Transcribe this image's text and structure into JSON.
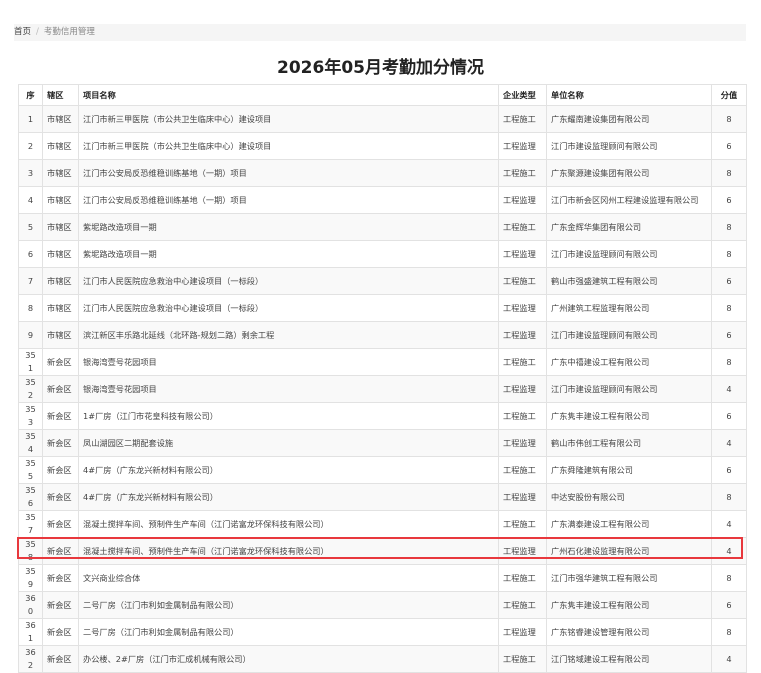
{
  "breadcrumb": {
    "home": "首页",
    "separator": "/",
    "current": "考勤信用管理"
  },
  "page_title": "2026年05月考勤加分情况",
  "table": {
    "headers": {
      "seq": "序",
      "district": "辖区",
      "project": "项目名称",
      "type": "企业类型",
      "unit": "单位名称",
      "score": "分值"
    },
    "rows": [
      {
        "seq": "1",
        "district": "市辖区",
        "project": "江门市新三甲医院（市公共卫生临床中心）建设项目",
        "type": "工程施工",
        "unit": "广东耀南建设集团有限公司",
        "score": "8"
      },
      {
        "seq": "2",
        "district": "市辖区",
        "project": "江门市新三甲医院（市公共卫生临床中心）建设项目",
        "type": "工程监理",
        "unit": "江门市建设监理顾问有限公司",
        "score": "6"
      },
      {
        "seq": "3",
        "district": "市辖区",
        "project": "江门市公安局反恐维稳训练基地（一期）项目",
        "type": "工程施工",
        "unit": "广东聚源建设集团有限公司",
        "score": "8"
      },
      {
        "seq": "4",
        "district": "市辖区",
        "project": "江门市公安局反恐维稳训练基地（一期）项目",
        "type": "工程监理",
        "unit": "江门市新会区冈州工程建设监理有限公司",
        "score": "6"
      },
      {
        "seq": "5",
        "district": "市辖区",
        "project": "紫坭路改造项目一期",
        "type": "工程施工",
        "unit": "广东金辉华集团有限公司",
        "score": "8"
      },
      {
        "seq": "6",
        "district": "市辖区",
        "project": "紫坭路改造项目一期",
        "type": "工程监理",
        "unit": "江门市建设监理顾问有限公司",
        "score": "8"
      },
      {
        "seq": "7",
        "district": "市辖区",
        "project": "江门市人民医院应急救治中心建设项目（一标段）",
        "type": "工程施工",
        "unit": "鹤山市强盛建筑工程有限公司",
        "score": "6"
      },
      {
        "seq": "8",
        "district": "市辖区",
        "project": "江门市人民医院应急救治中心建设项目（一标段）",
        "type": "工程监理",
        "unit": "广州建筑工程监理有限公司",
        "score": "8"
      },
      {
        "seq": "9",
        "district": "市辖区",
        "project": "滨江新区丰乐路北延线（北环路-规划二路）剩余工程",
        "type": "工程监理",
        "unit": "江门市建设监理顾问有限公司",
        "score": "6"
      },
      {
        "seq": "351",
        "district": "新会区",
        "project": "银海湾壹号花园项目",
        "type": "工程施工",
        "unit": "广东中禧建设工程有限公司",
        "score": "8"
      },
      {
        "seq": "352",
        "district": "新会区",
        "project": "银海湾壹号花园项目",
        "type": "工程监理",
        "unit": "江门市建设监理顾问有限公司",
        "score": "4"
      },
      {
        "seq": "353",
        "district": "新会区",
        "project": "1#厂房（江门市花皇科技有限公司）",
        "type": "工程施工",
        "unit": "广东隽丰建设工程有限公司",
        "score": "6"
      },
      {
        "seq": "354",
        "district": "新会区",
        "project": "凤山湖园区二期配套设施",
        "type": "工程监理",
        "unit": "鹤山市伟创工程有限公司",
        "score": "4"
      },
      {
        "seq": "355",
        "district": "新会区",
        "project": "4#厂房（广东龙兴新材料有限公司）",
        "type": "工程施工",
        "unit": "广东舜隆建筑有限公司",
        "score": "6"
      },
      {
        "seq": "356",
        "district": "新会区",
        "project": "4#厂房（广东龙兴新材料有限公司）",
        "type": "工程监理",
        "unit": "中达安股份有限公司",
        "score": "8"
      },
      {
        "seq": "357",
        "district": "新会区",
        "project": "混凝土搅拌车间、预制件生产车间（江门诺富龙环保科技有限公司）",
        "type": "工程施工",
        "unit": "广东满泰建设工程有限公司",
        "score": "4"
      },
      {
        "seq": "358",
        "district": "新会区",
        "project": "混凝土搅拌车间、预制件生产车间（江门诺富龙环保科技有限公司）",
        "type": "工程监理",
        "unit": "广州石化建设监理有限公司",
        "score": "4"
      },
      {
        "seq": "359",
        "district": "新会区",
        "project": "文兴商业综合体",
        "type": "工程施工",
        "unit": "江门市强华建筑工程有限公司",
        "score": "8"
      },
      {
        "seq": "360",
        "district": "新会区",
        "project": "二号厂房（江门市利如金属制品有限公司）",
        "type": "工程施工",
        "unit": "广东隽丰建设工程有限公司",
        "score": "6"
      },
      {
        "seq": "361",
        "district": "新会区",
        "project": "二号厂房（江门市利如金属制品有限公司）",
        "type": "工程监理",
        "unit": "广东铭睿建设管理有限公司",
        "score": "8"
      },
      {
        "seq": "362",
        "district": "新会区",
        "project": "办公楼、2#厂房（江门市汇成机械有限公司）",
        "type": "工程施工",
        "unit": "江门铭域建设工程有限公司",
        "score": "4"
      }
    ]
  },
  "colors": {
    "highlight_border": "#e8383d"
  }
}
